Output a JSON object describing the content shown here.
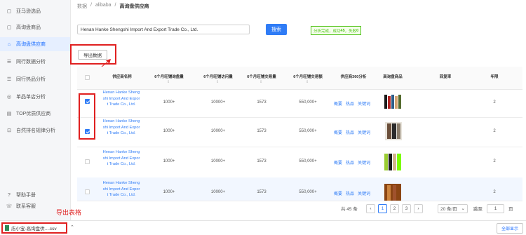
{
  "sidebar": {
    "items": [
      {
        "label": "亚马逊选品",
        "icon": "box-icon",
        "active": false
      },
      {
        "label": "高询盘商品",
        "icon": "box-icon",
        "active": false
      },
      {
        "label": "高询盘供应商",
        "icon": "store-icon",
        "active": true
      },
      {
        "label": "同行数据分析",
        "icon": "list-icon",
        "active": false
      },
      {
        "label": "同行热品分析",
        "icon": "list-icon",
        "active": false
      },
      {
        "label": "单品单店分析",
        "icon": "target-icon",
        "active": false
      },
      {
        "label": "TOP优质供应商",
        "icon": "chart-icon",
        "active": false
      },
      {
        "label": "自然排名规律分析",
        "icon": "lock-icon",
        "active": false
      }
    ],
    "help": "帮助手册",
    "contact": "联系客服"
  },
  "breadcrumb": [
    "数据",
    "alibaba",
    "高询盘供应商"
  ],
  "search": {
    "value": "Henan Hanke Shengshi Import And Export Trade Co., Ltd.",
    "button": "搜索"
  },
  "status": {
    "prefix": "分析完成，成功",
    "success": "45",
    "middle": "，失败",
    "failed": "0"
  },
  "export_button": "导出数据",
  "table": {
    "headers": [
      "供应商名称",
      "6个月旺铺询盘量",
      "6个月旺铺访问量",
      "6个月旺铺交易量",
      "6个月旺铺交易额",
      "供应商360分析",
      "高询盘商品",
      "回复率",
      "年限"
    ],
    "rows": [
      {
        "supplier": "Henan Hanke Shengshi Import And Export Trade Co., Ltd.",
        "inquiries": "1000+",
        "visits": "10000+",
        "trades": "1573",
        "amount": "550,000+",
        "links": [
          "概要",
          "热品",
          "关键词"
        ],
        "reply": "",
        "years": "2",
        "checked": true
      },
      {
        "supplier": "Henan Hanke Shengshi Import And Export Trade Co., Ltd.",
        "inquiries": "1000+",
        "visits": "10000+",
        "trades": "1573",
        "amount": "550,000+",
        "links": [
          "概要",
          "热品",
          "关键词"
        ],
        "reply": "",
        "years": "2",
        "checked": true
      },
      {
        "supplier": "Henan Hanke Shengshi Import And Export Trade Co., Ltd.",
        "inquiries": "1000+",
        "visits": "10000+",
        "trades": "1573",
        "amount": "550,000+",
        "links": [
          "概要",
          "热品",
          "关键词"
        ],
        "reply": "",
        "years": "2",
        "checked": false
      },
      {
        "supplier": "Henan Hanke Shengshi Import And Export Trade Co., Ltd.",
        "inquiries": "1000+",
        "visits": "10000+",
        "trades": "1573",
        "amount": "550,000+",
        "links": [
          "概要",
          "热品",
          "关键词"
        ],
        "reply": "",
        "years": "2",
        "checked": false
      }
    ]
  },
  "pagination": {
    "total": "共 45 条",
    "pages": [
      "1",
      "2",
      "3"
    ],
    "current": "1",
    "page_size": "20 条/页",
    "goto_label": "跳至",
    "goto_value": "1",
    "page_unit": "页"
  },
  "download": {
    "filename": "店小宝-高询盘供....csv",
    "show_all": "全部显示"
  },
  "annotation": {
    "label": "导出表格",
    "color": "#e02020"
  },
  "colors": {
    "accent": "#2f7cf6",
    "success": "#52c41a",
    "annotation": "#e02020"
  }
}
